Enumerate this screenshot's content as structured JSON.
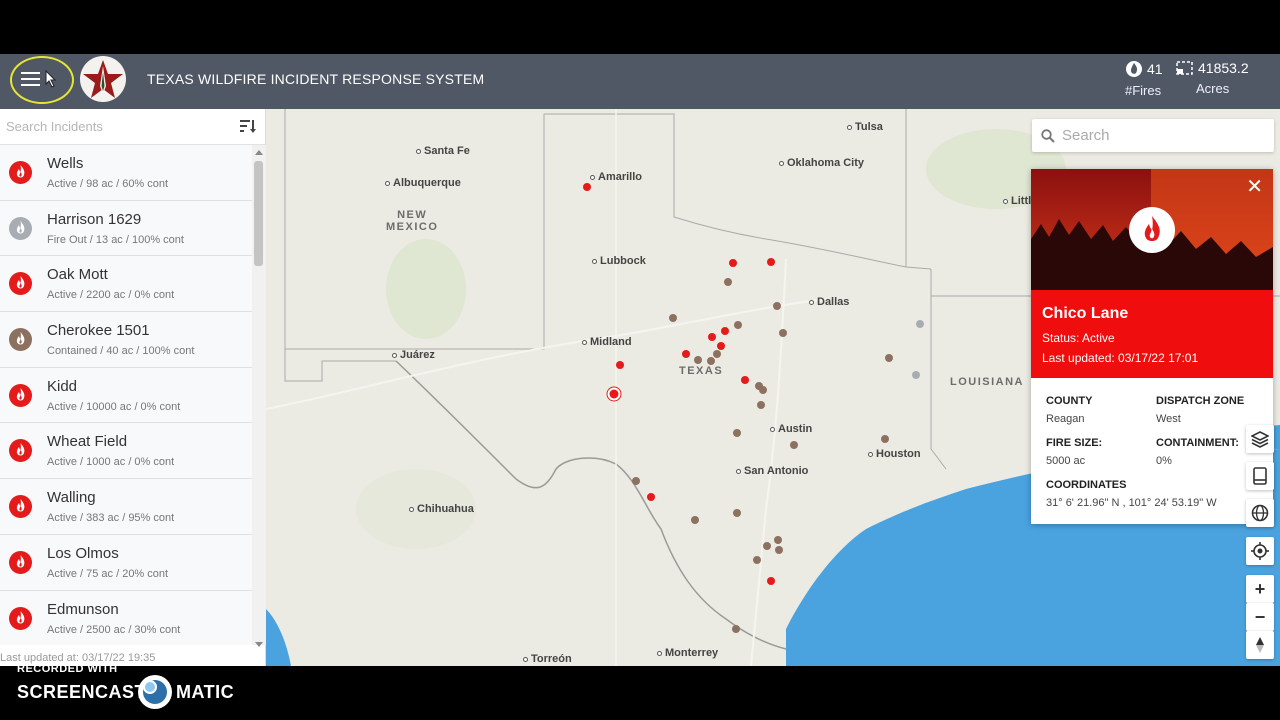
{
  "header": {
    "title": "TEXAS WILDFIRE INCIDENT RESPONSE SYSTEM",
    "fires_count": "41",
    "fires_label": "#Fires",
    "acres_count": "41853.2",
    "acres_label": "Acres"
  },
  "sidebar": {
    "search_placeholder": "Search Incidents",
    "last_updated": "Last updated at: 03/17/22 19:35",
    "incidents": [
      {
        "name": "Wells",
        "status": "Active / 98 ac / 60% cont",
        "kind": "active"
      },
      {
        "name": "Harrison 1629",
        "status": "Fire Out / 13 ac / 100% cont",
        "kind": "out"
      },
      {
        "name": "Oak Mott",
        "status": "Active / 2200 ac / 0% cont",
        "kind": "active"
      },
      {
        "name": "Cherokee 1501",
        "status": "Contained / 40 ac / 100% cont",
        "kind": "contained"
      },
      {
        "name": "Kidd",
        "status": "Active / 10000 ac / 0% cont",
        "kind": "active"
      },
      {
        "name": "Wheat Field",
        "status": "Active / 1000 ac / 0% cont",
        "kind": "active"
      },
      {
        "name": "Walling",
        "status": "Active / 383 ac / 95% cont",
        "kind": "active"
      },
      {
        "name": "Los Olmos",
        "status": "Active / 75 ac / 20% cont",
        "kind": "active"
      },
      {
        "name": "Edmunson",
        "status": "Active / 2500 ac / 30% cont",
        "kind": "active"
      }
    ]
  },
  "map": {
    "search_placeholder": "Search",
    "cities": {
      "tulsa": "Tulsa",
      "santa_fe": "Santa Fe",
      "oklahoma_city": "Oklahoma City",
      "amarillo": "Amarillo",
      "albuquerque": "Albuquerque",
      "little_rock": "Littl",
      "lubbock": "Lubbock",
      "dallas": "Dallas",
      "midland": "Midland",
      "juarez": "Juárez",
      "austin": "Austin",
      "san_antonio": "San Antonio",
      "houston": "Houston",
      "chihuahua": "Chihuahua",
      "torreon": "Torreón",
      "monterrey": "Monterrey"
    },
    "regions": {
      "new_mexico_1": "NEW",
      "new_mexico_2": "MEXICO",
      "texas": "TEXAS",
      "louisiana": "LOUISIANA"
    }
  },
  "popup": {
    "name": "Chico Lane",
    "status": "Status: Active",
    "updated": "Last updated: 03/17/22 17:01",
    "county_label": "COUNTY",
    "county_value": "Reagan",
    "zone_label": "DISPATCH ZONE",
    "zone_value": "West",
    "size_label": "FIRE SIZE:",
    "size_value": "5000 ac",
    "cont_label": "CONTAINMENT:",
    "cont_value": "0%",
    "coords_label": "COORDINATES",
    "coords_value": "31° 6' 21.96\" N , 101° 24' 53.19\" W"
  },
  "footer": {
    "recorded": "RECORDED WITH",
    "brand_left": "SCREENCAST",
    "brand_right": "MATIC"
  },
  "colors": {
    "header_bg": "#505866",
    "active_fire": "#e31b1b",
    "contained_fire": "#8c7160",
    "out_fire": "#a7adb2",
    "popup_red": "#f00d0d"
  }
}
